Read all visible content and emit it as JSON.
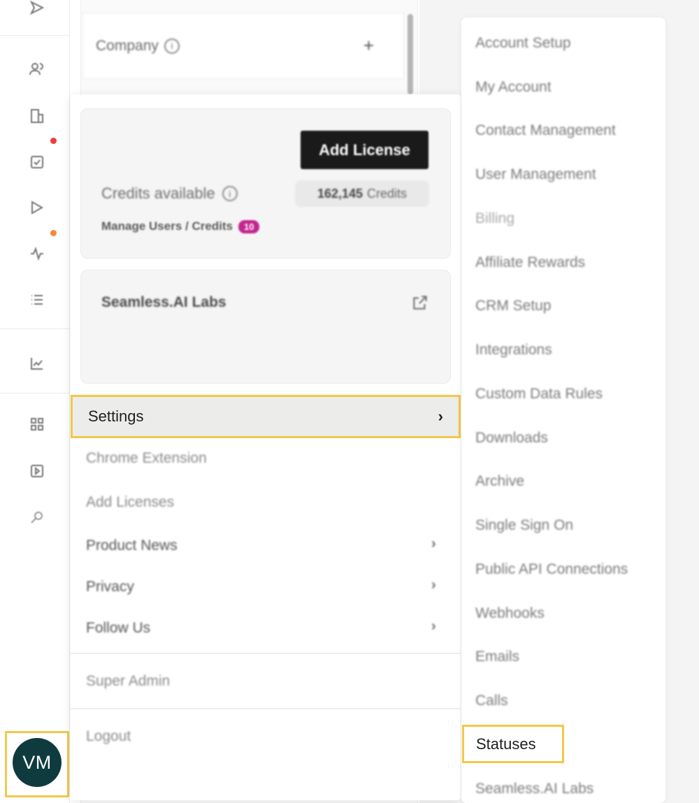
{
  "company": {
    "label": "Company",
    "info_icon": "info-icon",
    "add_icon": "plus-icon"
  },
  "rail": {
    "icons": [
      "send-icon",
      "users-icon",
      "building-icon",
      "tasks-icon",
      "sequence-icon",
      "activity-icon",
      "list-icon",
      "chart-icon",
      "apps-icon",
      "play-icon",
      "search-icon"
    ],
    "notification_colors": [
      "#ef3b3b",
      "#f5883a"
    ]
  },
  "avatar": {
    "initials": "VM",
    "color": "#0f3b3e"
  },
  "menu": {
    "add_license_button": "Add License",
    "credits_label": "Credits available",
    "credits_value": "162,145",
    "credits_unit": "Credits",
    "manage_users_label": "Manage Users / Credits",
    "manage_users_badge": "10",
    "labs_title": "Seamless.AI Labs",
    "settings_label": "Settings",
    "items": [
      {
        "label": "Chrome Extension"
      },
      {
        "label": "Add Licenses"
      },
      {
        "label": "Product News"
      },
      {
        "label": "Privacy"
      },
      {
        "label": "Follow Us"
      },
      {
        "label": "Super Admin"
      },
      {
        "label": "Logout"
      }
    ]
  },
  "submenu": {
    "items": [
      "Account Setup",
      "My Account",
      "Contact Management",
      "User Management",
      "Billing",
      "Affiliate Rewards",
      "CRM Setup",
      "Integrations",
      "Custom Data Rules",
      "Downloads",
      "Archive",
      "Single Sign On",
      "Public API Connections",
      "Webhooks",
      "Emails",
      "Calls",
      "Statuses",
      "Seamless.AI Labs"
    ]
  },
  "colors": {
    "highlight": "#f1c84a",
    "badge": "#c2268f"
  }
}
